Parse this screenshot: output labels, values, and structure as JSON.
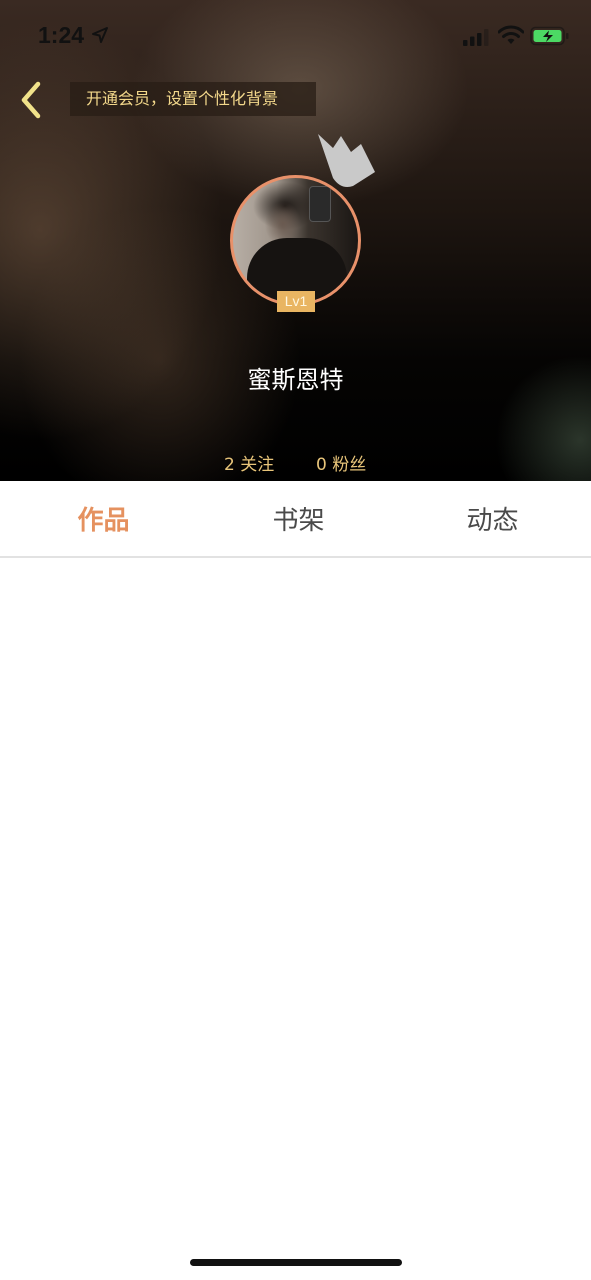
{
  "status_bar": {
    "time": "1:24",
    "icons": [
      "location-arrow-icon",
      "signal-icon",
      "wifi-icon",
      "battery-charging-icon"
    ],
    "battery_color": "#4cd964"
  },
  "header": {
    "back_icon": "chevron-left-icon",
    "promo_text": "开通会员，设置个性化背景",
    "crown_icon": "crown-icon",
    "level": "Lv1",
    "username": "蜜斯恩特",
    "following": "2 关注",
    "followers": "0 粉丝"
  },
  "tabs": [
    {
      "label": "作品",
      "active": true
    },
    {
      "label": "书架",
      "active": false
    },
    {
      "label": "动态",
      "active": false
    }
  ],
  "colors": {
    "accent": "#e5915f",
    "promo_text": "#f3d88b",
    "stats_text": "#e8c57a",
    "level_badge": "#e9b562",
    "avatar_border": "#e8916a"
  }
}
